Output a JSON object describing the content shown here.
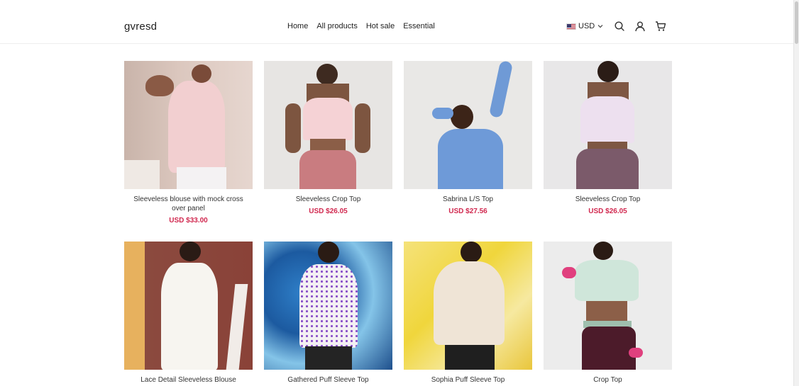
{
  "header": {
    "logo": "gvresd",
    "nav": [
      "Home",
      "All products",
      "Hot sale",
      "Essential"
    ],
    "currency": "USD"
  },
  "products": [
    {
      "name": "Sleeveless blouse with mock cross over panel",
      "price": "USD $33.00"
    },
    {
      "name": "Sleeveless Crop Top",
      "price": "USD $26.05"
    },
    {
      "name": "Sabrina L/S Top",
      "price": "USD $27.56"
    },
    {
      "name": "Sleeveless Crop Top",
      "price": "USD $26.05"
    },
    {
      "name": "Lace Detail Sleeveless Blouse",
      "price": ""
    },
    {
      "name": "Gathered Puff Sleeve Top",
      "price": ""
    },
    {
      "name": "Sophia Puff Sleeve Top",
      "price": ""
    },
    {
      "name": "Crop Top",
      "price": ""
    }
  ],
  "colors": {
    "price": "#d1284f",
    "border": "#eeeeee"
  },
  "icons": [
    "us-flag-icon",
    "chevron-down-icon",
    "search-icon",
    "account-icon",
    "cart-icon"
  ]
}
